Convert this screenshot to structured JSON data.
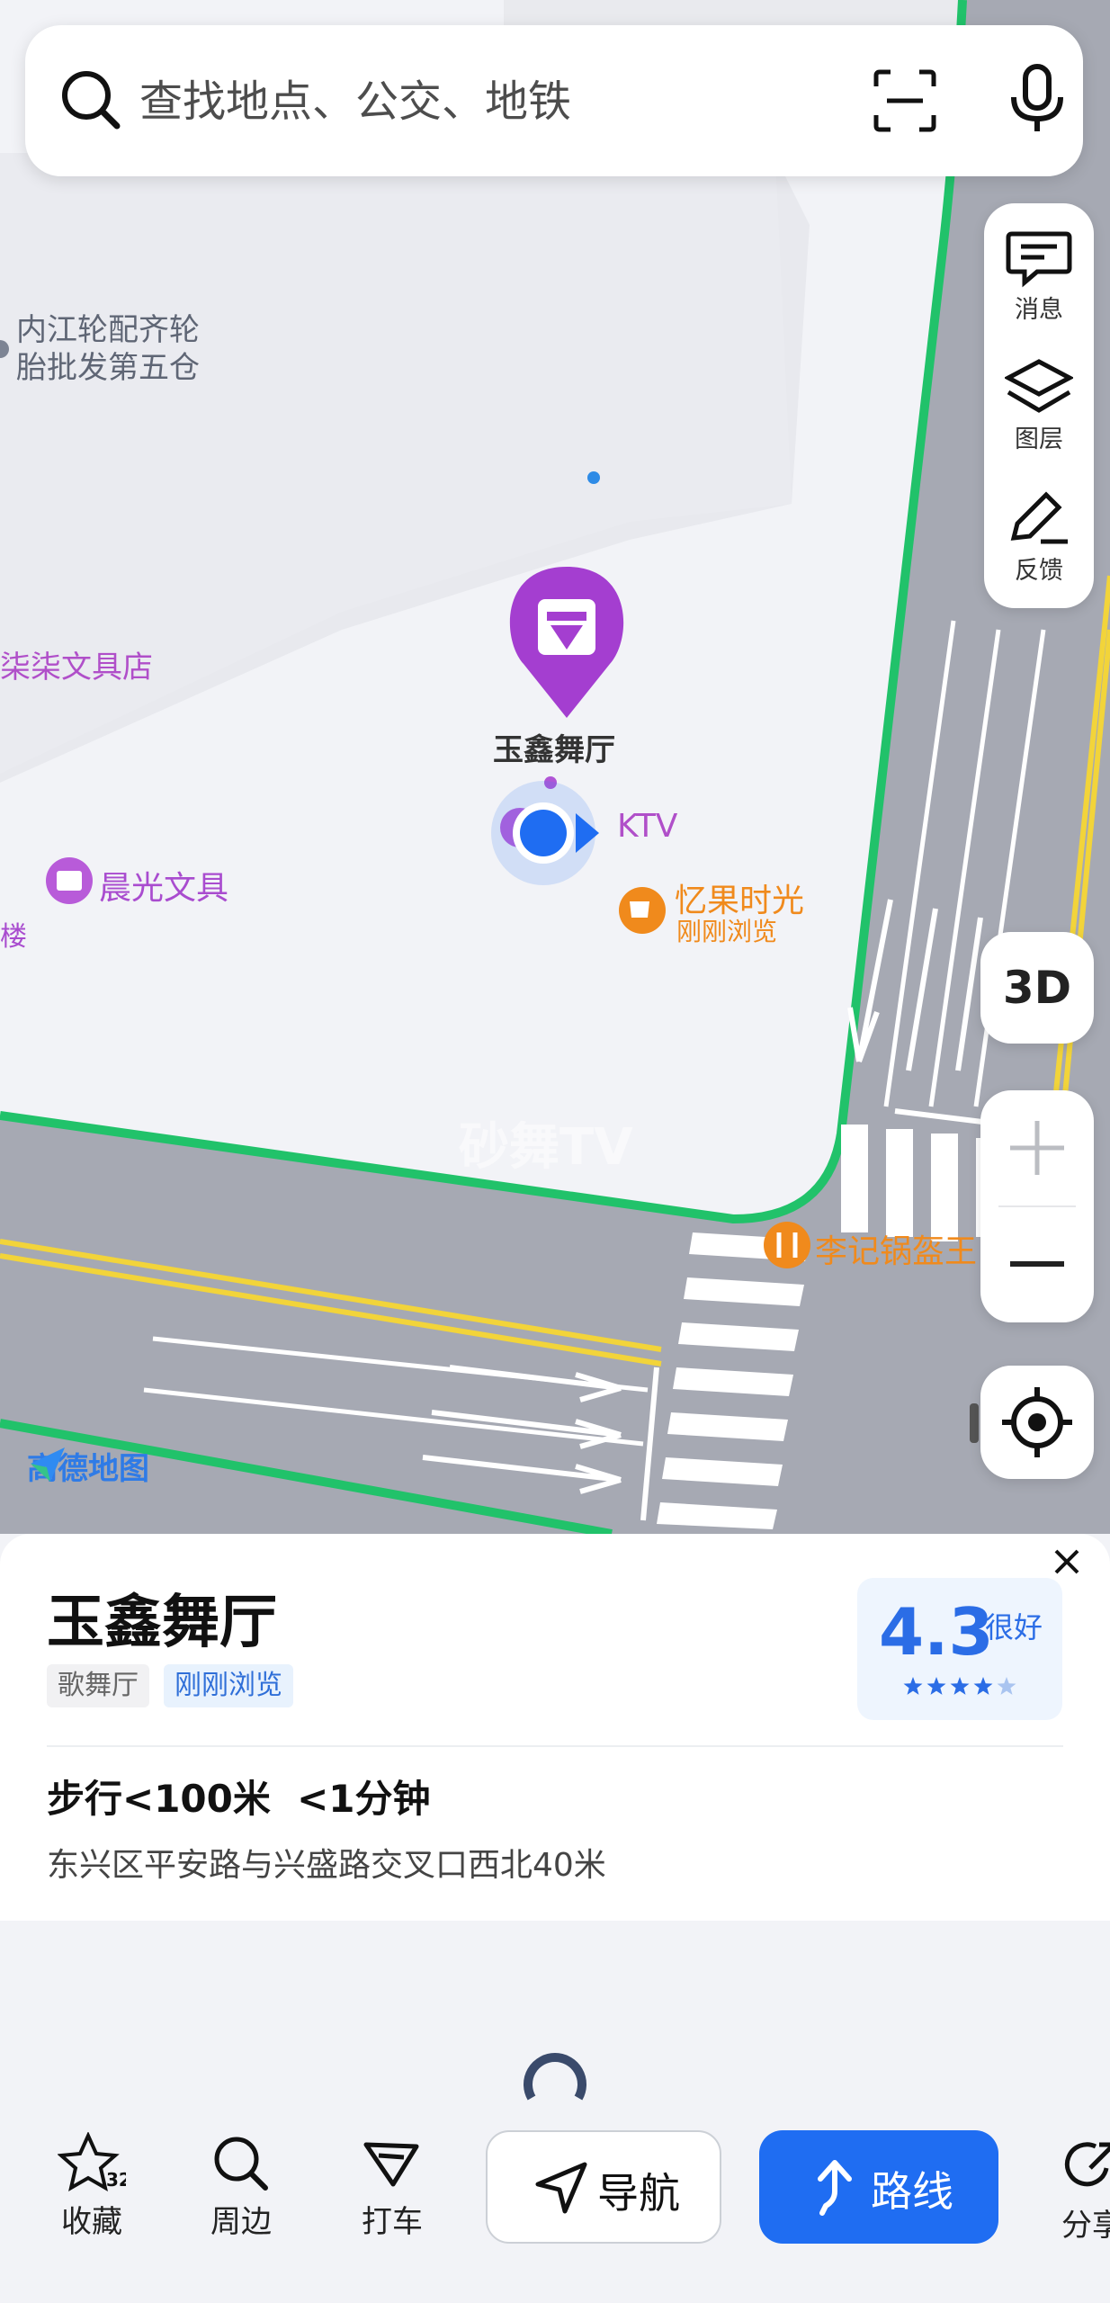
{
  "search": {
    "placeholder": "查找地点、公交、地铁"
  },
  "side_panel": {
    "messages": "消息",
    "layers": "图层",
    "feedback": "反馈"
  },
  "map_controls": {
    "view_3d": "3D"
  },
  "map_labels": {
    "tire_shop": "内江轮配齐轮\n胎批发第五仓",
    "stationery_store": "柒柒文具店",
    "selected_poi": "玉鑫舞厅",
    "ktv": "KTV",
    "chenguang": "晨光文具",
    "yiguo_name": "忆果时光",
    "yiguo_sub": "刚刚浏览",
    "hotpot": "李记锅盔王",
    "watermark": "砂舞TV",
    "brand": "高德地图",
    "edge_char": "楼"
  },
  "place": {
    "name": "玉鑫舞厅",
    "category": "歌舞厅",
    "recent_tag": "刚刚浏览",
    "rating": "4.3",
    "rating_word": "很好",
    "stars_filled": 4,
    "stars_total": 5,
    "walk_info": "步行<100米  <1分钟",
    "address": "东兴区平安路与兴盛路交叉口西北40米"
  },
  "bottom_bar": {
    "favorite": "收藏",
    "favorite_count": "32",
    "nearby": "周边",
    "taxi": "打车",
    "navigate": "导航",
    "route": "路线",
    "share": "分享"
  }
}
